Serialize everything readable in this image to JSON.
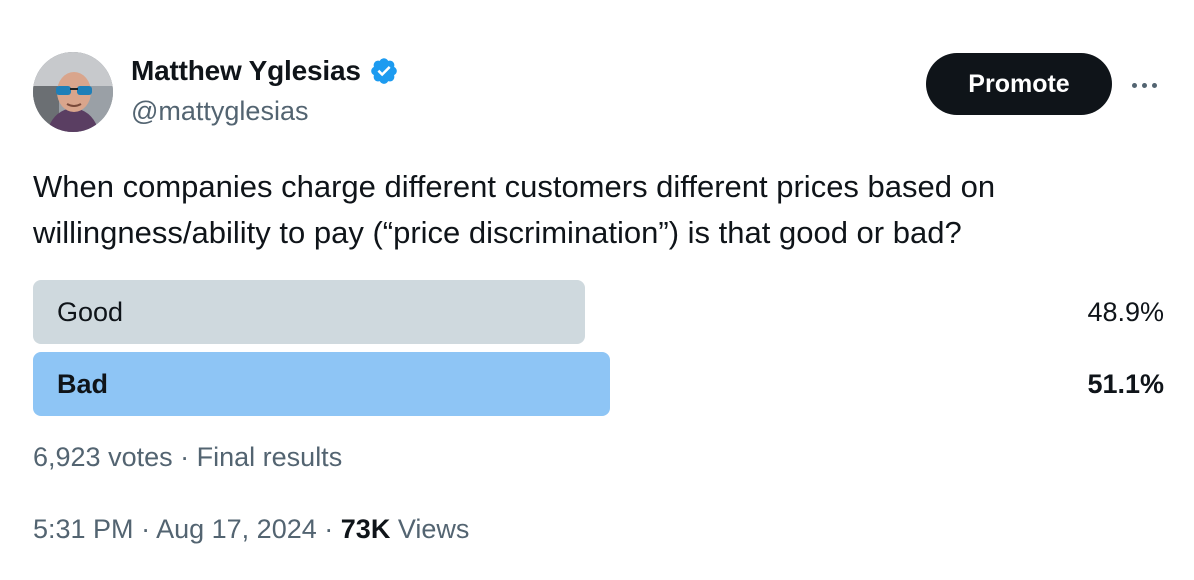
{
  "author": {
    "name": "Matthew Yglesias",
    "handle": "@mattyglesias",
    "verified": true
  },
  "actions": {
    "promote_label": "Promote",
    "more_icon": "more-horizontal-icon"
  },
  "tweet": {
    "text": "When companies charge different customers different prices based on willingness/ability to pay (“price discrimination”) is that good or bad?"
  },
  "poll": {
    "options": [
      {
        "label": "Good",
        "percent_text": "48.9%",
        "percent": 48.9,
        "winner": false,
        "color": "#cfd9de"
      },
      {
        "label": "Bad",
        "percent_text": "51.1%",
        "percent": 51.1,
        "winner": true,
        "color": "#8ec5f5"
      }
    ],
    "votes": "6,923 votes",
    "separator": "·",
    "status": "Final results"
  },
  "meta": {
    "time": "5:31 PM",
    "date": "Aug 17, 2024",
    "views_count": "73K",
    "views_label": "Views",
    "separator": "·"
  },
  "colors": {
    "text_primary": "#0f1419",
    "text_secondary": "#536471",
    "verified_blue": "#1d9bf0"
  }
}
